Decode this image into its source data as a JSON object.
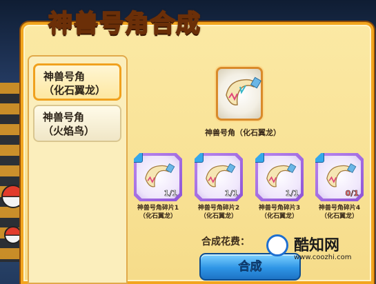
{
  "title": "神兽号角合成",
  "left_list": {
    "items": [
      {
        "line1": "神兽号角",
        "line2": "（化石翼龙）",
        "active": true
      },
      {
        "line1": "神兽号角",
        "line2": "（火焰鸟）",
        "active": false
      }
    ]
  },
  "result": {
    "label": "神兽号角（化石翼龙）",
    "icon": "horn-icon"
  },
  "fragments": [
    {
      "name": "神兽号角碎片1",
      "sub": "（化石翼龙）",
      "count": "1/1"
    },
    {
      "name": "神兽号角碎片2",
      "sub": "（化石翼龙）",
      "count": "1/1"
    },
    {
      "name": "神兽号角碎片3",
      "sub": "（化石翼龙）",
      "count": "1/1"
    },
    {
      "name": "神兽号角碎片4",
      "sub": "（化石翼龙）",
      "count": "0/1"
    }
  ],
  "cost": {
    "label": "合成花费：",
    "value": ""
  },
  "button": {
    "label": "合成"
  },
  "watermark": {
    "name": "酷知网",
    "url": "www.coozhi.com"
  },
  "colors": {
    "panel_border": "#f2a51e",
    "panel_fill": "#fbe9a4",
    "fragment_purple": "#8e54d6",
    "button_blue": "#2e95e6"
  }
}
